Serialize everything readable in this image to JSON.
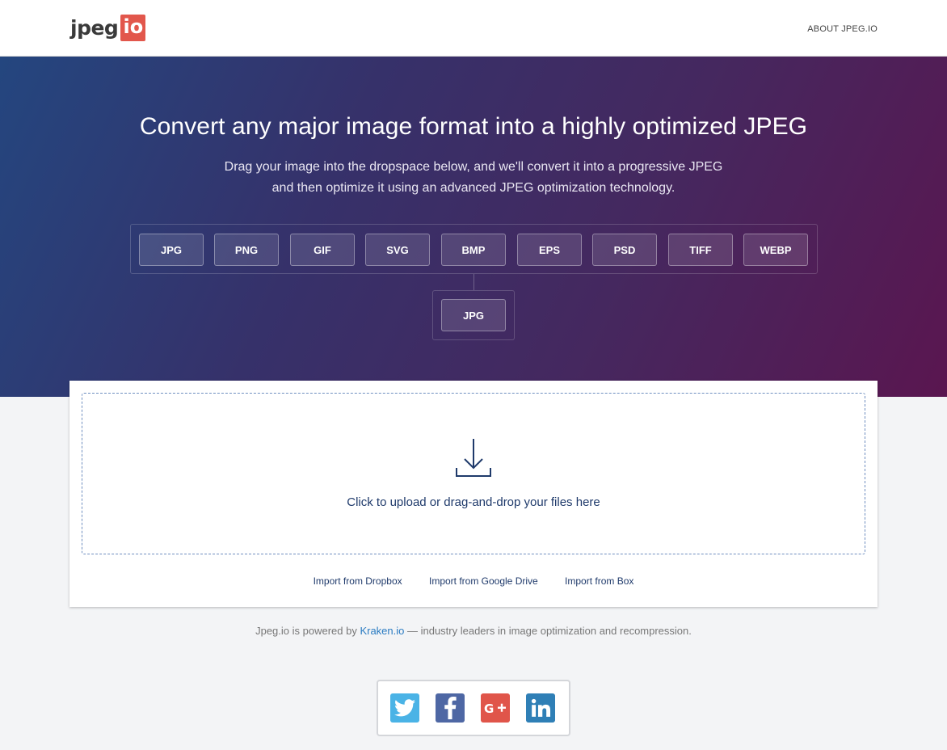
{
  "header": {
    "logo_main": "jpeg",
    "logo_box": "io",
    "nav_about": "ABOUT JPEG.IO"
  },
  "hero": {
    "title": "Convert any major image format into a highly optimized JPEG",
    "subtitle_line1": "Drag your image into the dropspace below, and we'll convert it into a progressive JPEG",
    "subtitle_line2": "and then optimize it using an advanced JPEG optimization technology.",
    "input_formats": [
      "JPG",
      "PNG",
      "GIF",
      "SVG",
      "BMP",
      "EPS",
      "PSD",
      "TIFF",
      "WEBP"
    ],
    "output_format": "JPG"
  },
  "upload": {
    "drop_text": "Click to upload or drag-and-drop your files here",
    "import_dropbox": "Import from Dropbox",
    "import_gdrive": "Import from Google Drive",
    "import_box": "Import from Box"
  },
  "footer": {
    "powered_prefix": "Jpeg.io is powered by ",
    "powered_link": "Kraken.io",
    "powered_suffix": " — industry leaders in image optimization and recompression."
  },
  "social": {
    "icons": [
      "twitter-icon",
      "facebook-icon",
      "google-plus-icon",
      "linkedin-icon"
    ]
  },
  "colors": {
    "logo_accent": "#e2574c",
    "hero_gradient_start": "#24467f",
    "hero_gradient_end": "#5a1650",
    "link_blue": "#2a7bc2",
    "dropzone_text": "#1f3a6b"
  }
}
